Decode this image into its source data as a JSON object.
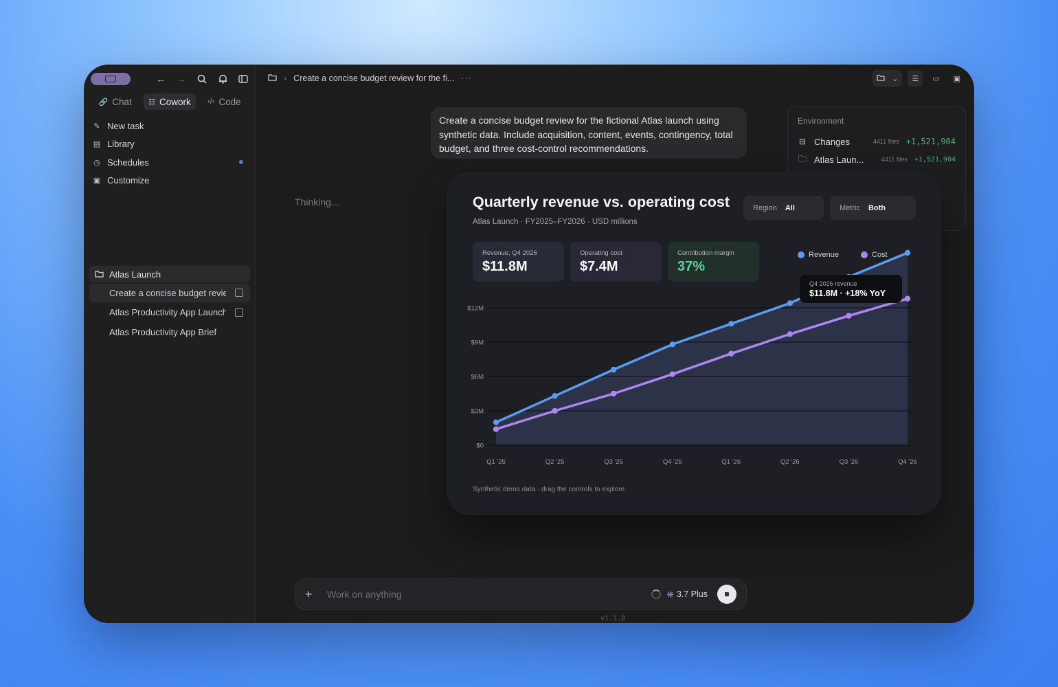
{
  "sidebar": {
    "tabs": [
      {
        "label": "Chat",
        "icon": "link-icon"
      },
      {
        "label": "Cowork",
        "icon": "grid-icon"
      },
      {
        "label": "Code",
        "icon": "code-icon"
      }
    ],
    "menu": [
      {
        "label": "New task",
        "icon": "edit-icon"
      },
      {
        "label": "Library",
        "icon": "library-icon"
      },
      {
        "label": "Schedules",
        "icon": "clock-icon"
      },
      {
        "label": "Customize",
        "icon": "briefcase-icon"
      }
    ],
    "project": {
      "name": "Atlas Launch",
      "items": [
        {
          "label": "Create a concise budget review for the fictional Atlas launch"
        },
        {
          "label": "Atlas Productivity App Launch"
        },
        {
          "label": "Atlas Productivity App Brief"
        }
      ]
    }
  },
  "header": {
    "breadcrumb": "Create a concise budget review for the fi...",
    "more": "···"
  },
  "conversation": {
    "user_message": "Create a concise budget review for the fictional Atlas launch using synthetic data. Include acquisition, content, events, contingency, total budget, and three cost-control recommendations.",
    "status": "Thinking..."
  },
  "environment": {
    "title": "Environment",
    "rows": [
      {
        "label": "Changes",
        "files": "4411 files",
        "delta": "+1,521,904"
      },
      {
        "label": "Atlas Laun...",
        "files": "4411 files",
        "delta": "+1,521,904"
      }
    ]
  },
  "composer": {
    "placeholder": "Work on anything",
    "model": "3.7 Plus"
  },
  "version": "v1.1.8",
  "card": {
    "title": "Quarterly revenue vs. operating cost",
    "subtitle": "Atlas Launch · FY2025–FY2026 · USD millions",
    "region": {
      "label": "Region",
      "value": "All"
    },
    "metric": {
      "label": "Metric",
      "value": "Both"
    },
    "kpis": [
      {
        "label": "Revenue, Q4 2026",
        "value": "$11.8M"
      },
      {
        "label": "Operating cost",
        "value": "$7.4M"
      },
      {
        "label": "Contribution margin",
        "value": "37%"
      }
    ],
    "tooltip": {
      "label": "Q4 2026 revenue",
      "value": "$11.8M · +18% YoY"
    },
    "footer": "Synthetic demo data · drag the controls to explore"
  },
  "colors": {
    "revenue": "#5b9cf0",
    "cost": "#ad86ef",
    "margin": "#5ed0a0"
  },
  "chart_data": {
    "type": "line",
    "title": "Quarterly revenue vs. operating cost",
    "categories": [
      "Q1 '25",
      "Q2 '25",
      "Q3 '25",
      "Q4 '25",
      "Q1 '26",
      "Q2 '26",
      "Q3 '26",
      "Q4 '26"
    ],
    "series": [
      {
        "name": "Revenue",
        "values": [
          2.0,
          4.3,
          6.6,
          8.8,
          10.6,
          12.4,
          14.7,
          16.8
        ]
      },
      {
        "name": "Cost",
        "values": [
          1.4,
          3.0,
          4.5,
          6.2,
          8.0,
          9.7,
          11.3,
          12.8
        ]
      }
    ],
    "yticks": [
      "$0",
      "$3M",
      "$6M",
      "$9M",
      "$12M"
    ],
    "ylim": [
      0,
      12
    ],
    "grid": true,
    "legend": "top-right"
  }
}
